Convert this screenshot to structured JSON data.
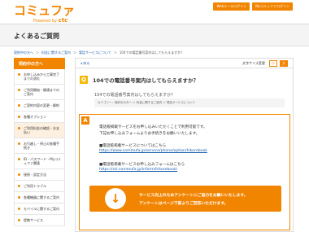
{
  "header": {
    "logo_main": "コミュファ",
    "logo_sub_prefix": "Powered by",
    "logo_sub_brand": "ctc",
    "links": [
      "Webメールログイン",
      "Myコミュファログイン"
    ]
  },
  "page_title": "よくあるご質問",
  "breadcrumb": {
    "items": [
      "契約中の方へ",
      "＞",
      "料金に関するご案内",
      "＞",
      "電話サービスについて",
      "＞",
      "104での電話番号案内はしてもらえますか？"
    ]
  },
  "sidebar": {
    "heading": "契約中の方へ",
    "items": [
      "お申し込みから工事完了までの流れ",
      "ご利用開始・開通までのご案内",
      "ご契約内容の変更・解約",
      "各種オプション",
      "ご利用料金の確認・お支払い",
      "お引越し・停止の各種手続き",
      "ID・パスワード・Myコミュファ関連",
      "接続・設定方法",
      "ご利用トラブル",
      "各種機器に関するご案内",
      "モバイルに関するご案内",
      "提携サービス"
    ]
  },
  "main": {
    "back_label": "戻る",
    "font_size_label": "文字サイズ変更",
    "font_small": "小",
    "font_large": "大",
    "q_badge": "Q",
    "question_title": "104での電話番号案内はしてもらえますか？",
    "question_body": "104での電話番号案内はしてもらえますか？",
    "category": "カテゴリー：契約中の方へ ＞ 料金に関するご案内 ＞ 電話サービスについて",
    "a_badge": "A",
    "answer_line1": "電話帳掲載サービスをお申し込みいただくことで利用可能です。",
    "answer_line2": "下記お申し込みフォームよりお手続きをお願いいたします。",
    "answer_head1": "■電話帳掲載サービスについてはこちら",
    "answer_url1": "https://www.commufa.jp/service/phone/option/hikorebook",
    "answer_head2": "■電話帳掲載サービスお申し込みフォームはこちら",
    "answer_url2": "https://ssl.commufa.jp/inform/hikorebook/",
    "survey_line1": "サービス向上のためアンケートにご協力をお願いいたします。",
    "survey_line2": "アンケートはページ下部よりご回答いただけます。"
  },
  "colors": {
    "accent": "#f28500",
    "link": "#1a5dad",
    "question_badge": "#f5b800"
  }
}
